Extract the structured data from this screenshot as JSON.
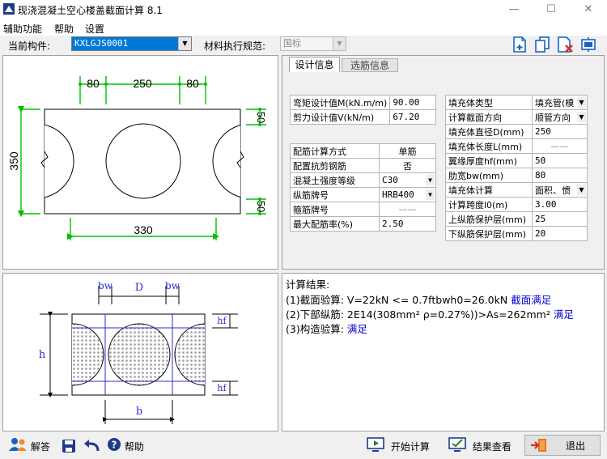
{
  "app": {
    "title": "现浇混凝土空心楼盖截面计算 8.1",
    "minimize": "—",
    "maximize": "☐",
    "close": "✕"
  },
  "menu": [
    "辅助功能",
    "帮助",
    "设置"
  ],
  "toolbar": {
    "component_label": "当前构件:",
    "component_value": "KXLGJS0001",
    "spec_label": "材料执行规范:",
    "spec_value": "国标"
  },
  "tabs": [
    "设计信息",
    "选筋信息"
  ],
  "diagram_top": {
    "dims": [
      "80",
      "250",
      "80"
    ],
    "side_dims": [
      "50",
      "50"
    ],
    "height": "350",
    "bottom": "330"
  },
  "diagram_bottom": {
    "bw": "bw",
    "d": "D",
    "h": "h",
    "hf": "hf",
    "b": "b"
  },
  "table1": [
    {
      "label": "弯矩设计值M(kN.m/m)",
      "value": "90.00"
    },
    {
      "label": "剪力设计值V(kN/m)",
      "value": "67.20"
    }
  ],
  "table2": [
    {
      "label": "配筋计算方式",
      "value": "单筋",
      "dropdown": false
    },
    {
      "label": "配置抗剪钢筋",
      "value": "否",
      "dropdown": false
    },
    {
      "label": "混凝土强度等级",
      "value": "C30",
      "dropdown": true
    },
    {
      "label": "纵筋牌号",
      "value": "HRB400",
      "dropdown": true
    },
    {
      "label": "箍筋牌号",
      "value": "——",
      "dropdown": false
    },
    {
      "label": "最大配筋率(%)",
      "value": "2.50",
      "dropdown": false
    }
  ],
  "table3": [
    {
      "label": "填充体类型",
      "value": "填充管(模",
      "dropdown": true
    },
    {
      "label": "计算截面方向",
      "value": "顺管方向",
      "dropdown": true
    },
    {
      "label": "填充体直径D(mm)",
      "value": "250",
      "dropdown": false
    },
    {
      "label": "填充体长度L(mm)",
      "value": "——",
      "dropdown": false
    },
    {
      "label": "翼缘厚度hf(mm)",
      "value": "50",
      "dropdown": false
    },
    {
      "label": "肋宽bw(mm)",
      "value": "80",
      "dropdown": false
    },
    {
      "label": "填充体计算",
      "value": "面积、惯",
      "dropdown": true
    },
    {
      "label": "计算跨度l0(m)",
      "value": "3.00",
      "dropdown": false
    },
    {
      "label": "上纵筋保护层(mm)",
      "value": "25",
      "dropdown": false
    },
    {
      "label": "下纵筋保护层(mm)",
      "value": "20",
      "dropdown": false
    }
  ],
  "results": {
    "title": "计算结果:",
    "line1_a": "(1)截面验算: V=22kN <= 0.7ftbwh0=26.0kN",
    "line1_b": "截面满足",
    "line2_a": "(2)下部纵筋: 2E14(308mm² ρ=0.27%))>As=262mm²",
    "line2_b": "满足",
    "line3_a": "(3)构造验算:",
    "line3_b": "满足"
  },
  "bottom": {
    "answer": "解答",
    "help": "帮助",
    "start": "开始计算",
    "view": "结果查看",
    "exit": "退出"
  },
  "colors": {
    "dim_green": "#00c000",
    "result_blue": "#0000cc",
    "hatch_gray": "#9a9a9a"
  }
}
